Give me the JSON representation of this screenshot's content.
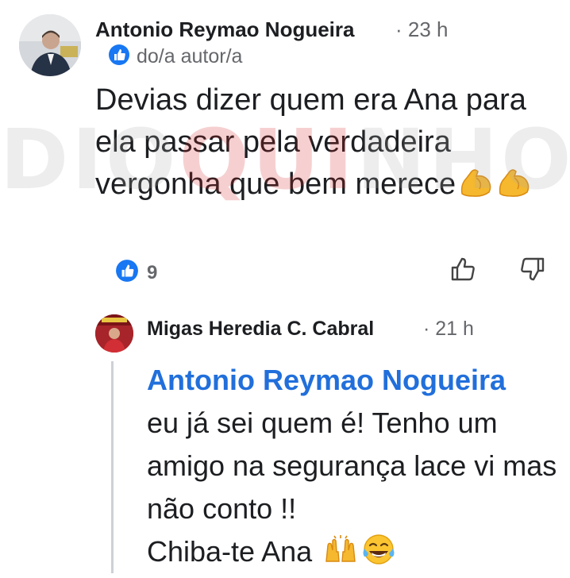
{
  "watermark": {
    "part1": "DIO",
    "part2": "QUI",
    "part3": "NHO"
  },
  "comment": {
    "author": "Antonio Reymao Nogueira",
    "time": "· 23 h",
    "badge_label": "do/a autor/a",
    "text": "Devias dizer quem era Ana para ela passar pela verdadeira vergonha que bem merece",
    "emojis": [
      "flexed-biceps",
      "flexed-biceps"
    ],
    "reaction_count": "9"
  },
  "reply": {
    "author": "Migas Heredia C. Cabral",
    "time": "· 21 h",
    "mention": "Antonio Reymao Nogueira",
    "line1": "eu já sei quem é! Tenho um amigo na segurança lace vi mas não conto !!",
    "line2": "Chiba-te Ana",
    "emojis": [
      "raising-hands",
      "tears-of-joy"
    ]
  },
  "colors": {
    "mention": "#216fdb",
    "like_badge": "#1877f2",
    "meta": "#65676b"
  }
}
